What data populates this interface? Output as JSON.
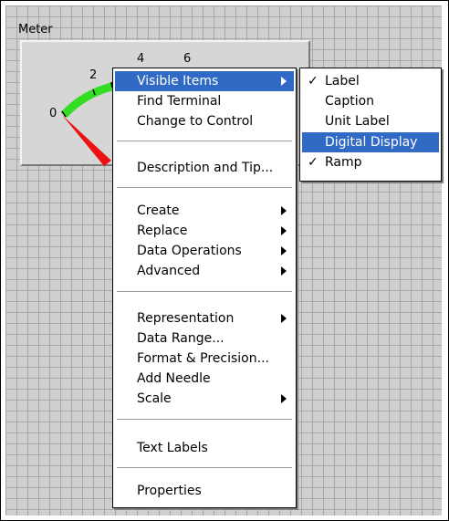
{
  "meter": {
    "label": "Meter",
    "scale": [
      "0",
      "2",
      "4",
      "6"
    ],
    "colors": {
      "ramp_green": "#33dd22",
      "ramp_red": "#ee1111",
      "needle": "#000000"
    }
  },
  "context_menu": {
    "items": [
      {
        "label": "Visible Items",
        "submenu": true,
        "highlighted": true
      },
      {
        "label": "Find Terminal"
      },
      {
        "label": "Change to Control"
      },
      {
        "label": "Description and Tip..."
      },
      {
        "label": "Create",
        "submenu": true
      },
      {
        "label": "Replace",
        "submenu": true
      },
      {
        "label": "Data Operations",
        "submenu": true
      },
      {
        "label": "Advanced",
        "submenu": true
      },
      {
        "label": "Representation",
        "submenu": true
      },
      {
        "label": "Data Range..."
      },
      {
        "label": "Format & Precision..."
      },
      {
        "label": "Add Needle"
      },
      {
        "label": "Scale",
        "submenu": true
      },
      {
        "label": "Text Labels"
      },
      {
        "label": "Properties"
      }
    ]
  },
  "visible_items_submenu": {
    "items": [
      {
        "label": "Label",
        "checked": true
      },
      {
        "label": "Caption",
        "checked": false
      },
      {
        "label": "Unit Label",
        "checked": false
      },
      {
        "label": "Digital Display",
        "checked": false,
        "highlighted": true
      },
      {
        "label": "Ramp",
        "checked": true
      }
    ],
    "check_glyph": "✓"
  },
  "colors": {
    "highlight": "#316ac5",
    "panel_bg": "#cfcfcf",
    "grid": "#a6a6a6"
  }
}
